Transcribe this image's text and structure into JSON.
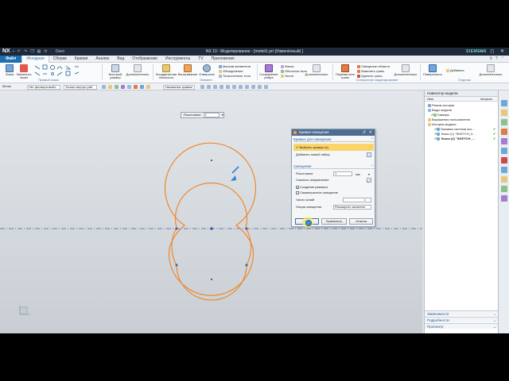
{
  "window": {
    "app_logo": "NX",
    "title": "NX 10 - Моделирование - [model1.prt (Изменённый) ]",
    "brand": "SIEMENS",
    "qat_labels": [
      "Окно"
    ],
    "win_controls": "— ◻ ✕"
  },
  "menu": {
    "file_tab": "Файл",
    "tabs": [
      "Исходная",
      "Сборки",
      "Кривая",
      "Анализ",
      "Вид",
      "Отображение",
      "Инструменты",
      "TV",
      "Приложение"
    ],
    "active_tab_index": 0
  },
  "ribbon": {
    "sketch_group": {
      "label": "Прямой эскиз",
      "buttons": [
        "Эскиз",
        "Закончить эскиз",
        "Ещё"
      ]
    },
    "quick_buttons": [
      "Быстрый размер",
      "Дополнительно"
    ],
    "feature_group": {
      "label": "Элемент",
      "buttons": [
        "Координатная плоскость",
        "Вытягивание",
        "Отверстие"
      ],
      "small": [
        "Массив элементов",
        "Объединение",
        "Тонкостенное тело"
      ]
    },
    "synch_group": {
      "buttons": [
        "Сопряжение ребра",
        "Дополнительно"
      ],
      "small": [
        "Фаска",
        "Оболочка тела",
        "Уклон"
      ]
    },
    "direct_group": {
      "label": "Синхронное моделирование",
      "buttons": [
        "Переместить грань",
        "Дополнительно"
      ],
      "small": [
        "Смещение области",
        "Заменить грань",
        "Удалить грань"
      ]
    },
    "surface_group": {
      "label": "Отделка",
      "buttons": [
        "Поверхность",
        "Добавить",
        "Дополнительно"
      ]
    }
  },
  "selection_bar": {
    "menu_label": "Меню",
    "filter": "Нет фильтра выбо",
    "scope": "Только внутри раб",
    "curve_rule": "Связанные кривые"
  },
  "dimension_popup": {
    "label": "Расстояние",
    "value": "1"
  },
  "dialog": {
    "title": "Кривая смещения",
    "sec1_title": "Кривые для смещения",
    "select_curve": "Выбрать кривую (4)",
    "add_new_set": "Добавить новый набор",
    "sec2_title": "Смещение",
    "distance_label": "Расстояние",
    "distance_value": "1",
    "distance_unit": "мм",
    "reverse_dir": "Сменить направление",
    "create_dim": "Создание размера",
    "create_dim_checked": true,
    "symmetric": "Симметричное смещение",
    "symmetric_checked": false,
    "copies_label": "Число копий",
    "copies_value": "1",
    "corner_label": "Опция смещения",
    "corner_value": "Расширить касатель",
    "btn_ok": "<OK>",
    "btn_apply": "Применить",
    "btn_cancel": "Отмена"
  },
  "navigator": {
    "title": "Навигатор модели",
    "col_name": "Имя",
    "col_updated": "Актуаль",
    "items": [
      {
        "label": "Режим истории",
        "icon": "history-icon",
        "status": ""
      },
      {
        "label": "Виды модели",
        "icon": "views-icon",
        "status": ""
      },
      {
        "label": "Камеры",
        "icon": "camera-icon",
        "status": ""
      },
      {
        "label": "Выражения пользователя",
        "icon": "expression-icon",
        "status": ""
      },
      {
        "label": "История модели",
        "icon": "folder-icon",
        "status": ""
      },
      {
        "label": "Базовая система коо...",
        "icon": "csys-icon",
        "status": "✔"
      },
      {
        "label": "Эскиз (1) \"SKETCH_0...",
        "icon": "sketch-icon",
        "status": "✔"
      },
      {
        "label": "Эскиз (2) \"SKETCH_...",
        "icon": "sketch-icon",
        "status": "✔"
      }
    ],
    "footers": [
      "Зависимости",
      "Подробности",
      "Просмотр"
    ]
  },
  "colors": {
    "curve": "#f0882c",
    "selected_highlight": "#fbd46a",
    "accent_blue": "#1e6fb0",
    "dialog_header": "#4c6d91"
  }
}
